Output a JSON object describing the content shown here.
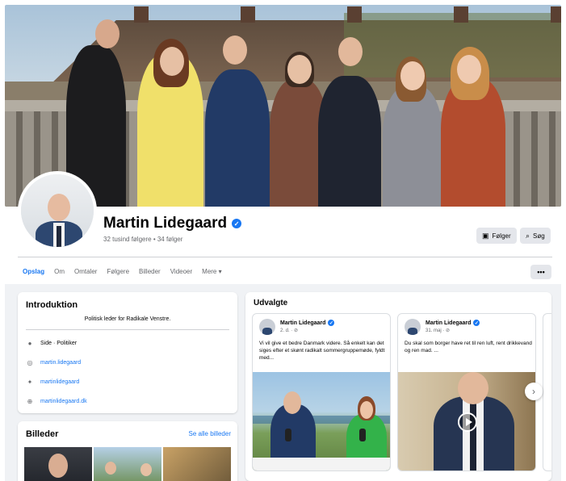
{
  "profile": {
    "name": "Martin Lidegaard",
    "followers_text": "32 tusind følgere • 34 følger",
    "follow_button": "Følger",
    "search_button": "Søg"
  },
  "tabs": [
    {
      "label": "Opslag"
    },
    {
      "label": "Om"
    },
    {
      "label": "Omtaler"
    },
    {
      "label": "Følgere"
    },
    {
      "label": "Billeder"
    },
    {
      "label": "Videoer"
    },
    {
      "label": "Mere ▾"
    }
  ],
  "more_options": "•••",
  "intro": {
    "title": "Introduktion",
    "bio": "Politisk leder for Radikale Venstre.",
    "items": [
      {
        "icon": "info-icon",
        "text": "Side · Politiker"
      },
      {
        "icon": "instagram-icon",
        "text": "martin.lidegaard"
      },
      {
        "icon": "twitter-icon",
        "text": "martinlidegaard"
      },
      {
        "icon": "globe-icon",
        "text": "martinlidegaard.dk"
      }
    ]
  },
  "photos": {
    "title": "Billeder",
    "see_all": "Se alle billeder"
  },
  "featured": {
    "title": "Udvalgte",
    "posts": [
      {
        "author": "Martin Lidegaard",
        "date": "2. d. · ⊘",
        "text": "Vi vil give et bedre Danmark videre. Så enkelt kan det siges efter et skønt radikalt sommergruppemøde, fyldt med..."
      },
      {
        "author": "Martin Lidegaard",
        "date": "31. maj · ⊘",
        "text": "Du skal som borger have ret til ren luft, rent drikkevand og ren mad. ..."
      }
    ]
  },
  "colors": {
    "accent": "#1877f2",
    "feed_bg": "#f0f2f5",
    "button_bg": "#e4e6eb"
  }
}
